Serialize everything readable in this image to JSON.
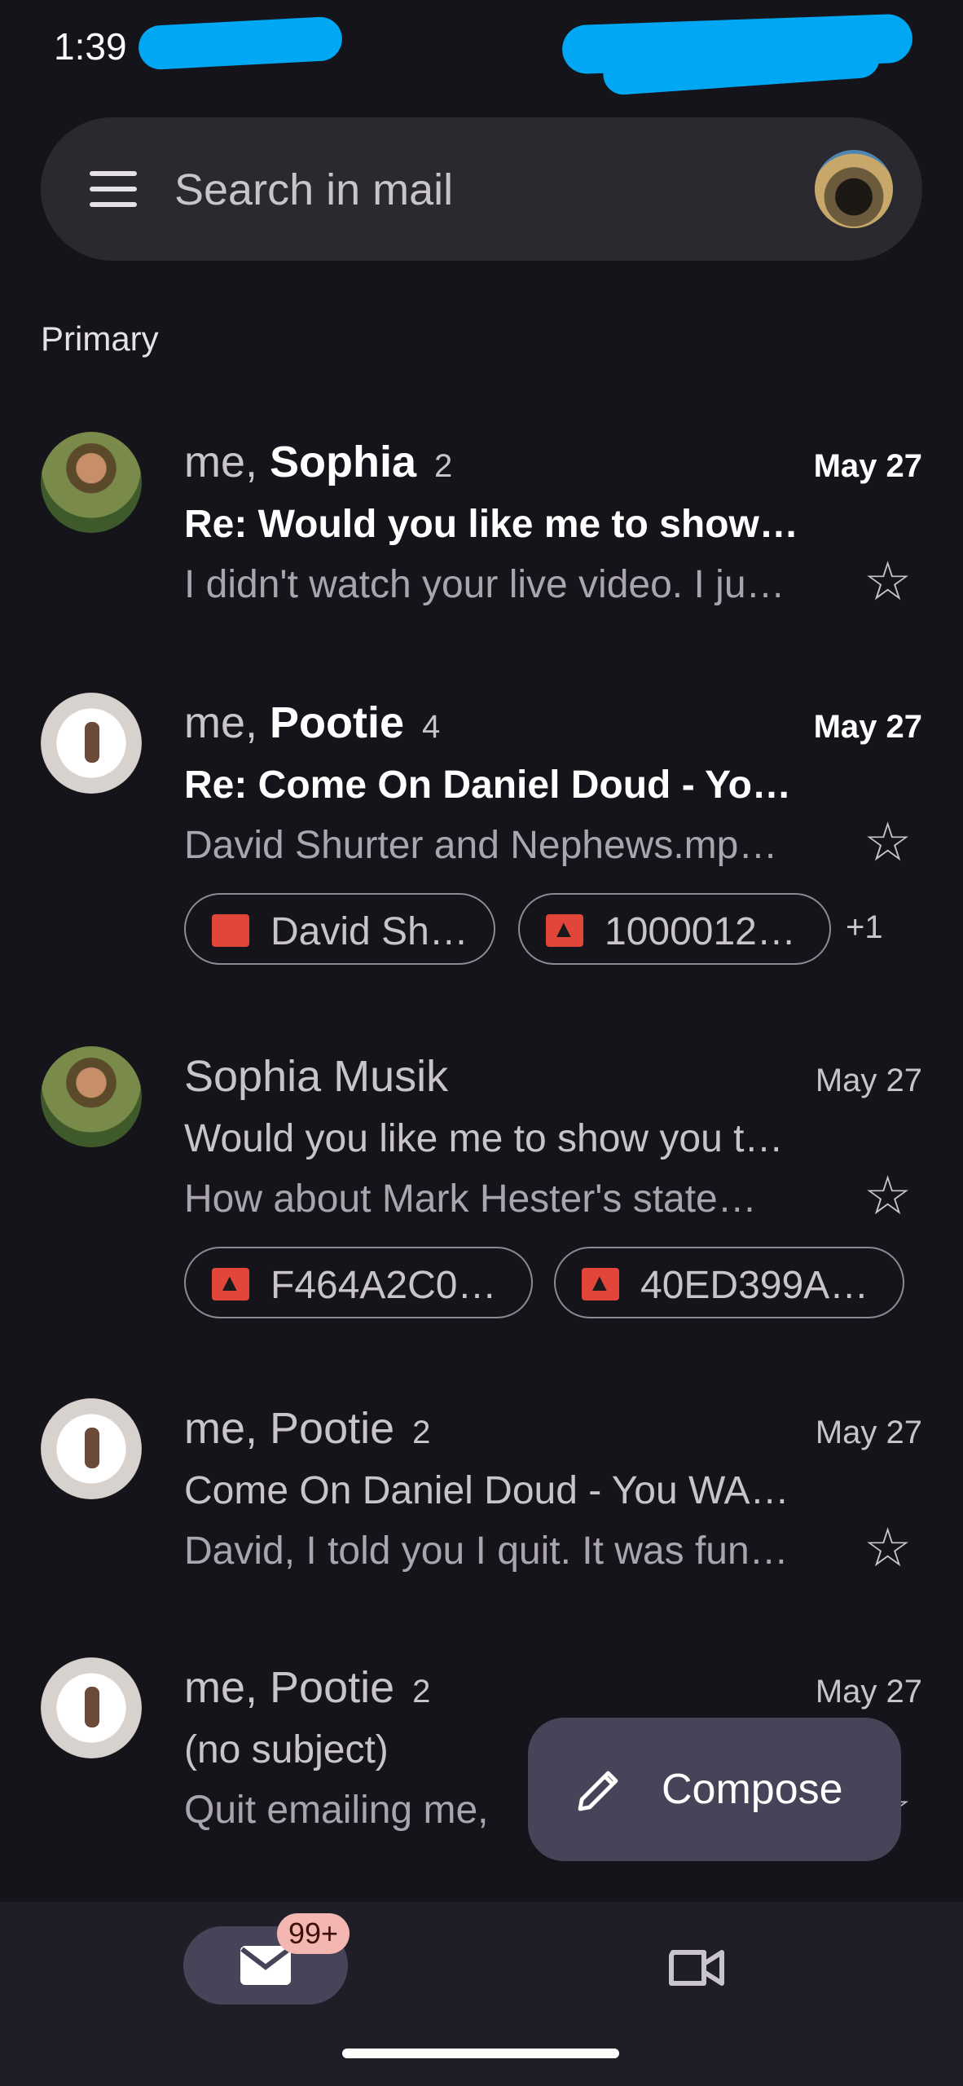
{
  "status_bar": {
    "time": "1:39"
  },
  "search": {
    "placeholder": "Search in mail"
  },
  "section": {
    "label": "Primary"
  },
  "emails": [
    {
      "sender_prefix": "me, ",
      "sender_bold": "Sophia",
      "count": "2",
      "date": "May 27",
      "subject": "Re: Would you like me to show…",
      "snippet": "I didn't watch your live video. I ju…",
      "unread": true
    },
    {
      "sender_prefix": "me, ",
      "sender_bold": "Pootie",
      "count": "4",
      "date": "May 27",
      "subject": "Re: Come On Daniel Doud - Yo…",
      "snippet": "David Shurter and Nephews.mp…",
      "unread": true,
      "attachments": [
        {
          "icon": "video-file-icon",
          "label": "David Sh…"
        },
        {
          "icon": "image-file-icon",
          "label": "1000012…"
        }
      ],
      "more_attachments": "+1"
    },
    {
      "sender": "Sophia Musik",
      "date": "May 27",
      "subject": "Would you like me to show you t…",
      "snippet": "How about Mark Hester's state…",
      "unread": false,
      "attachments": [
        {
          "icon": "image-file-icon",
          "label": "F464A2C0…"
        },
        {
          "icon": "image-file-icon",
          "label": "40ED399A…"
        }
      ]
    },
    {
      "sender": "me, Pootie",
      "count": "2",
      "date": "May 27",
      "subject": "Come On Daniel Doud - You WA…",
      "snippet": "David, I told you I quit. It was fun…",
      "unread": false
    },
    {
      "sender": "me, Pootie",
      "count": "2",
      "date": "May 27",
      "subject": "(no subject)",
      "snippet": "Quit emailing me,",
      "unread": false
    }
  ],
  "compose": {
    "label": "Compose"
  },
  "bottom_nav": {
    "mail_badge": "99+"
  },
  "colors": {
    "background": "#15141a",
    "surface": "#2a2930",
    "compose_bg": "#474459",
    "attachment_icon": "#e2463b",
    "badge_bg": "#f3b6b0"
  }
}
